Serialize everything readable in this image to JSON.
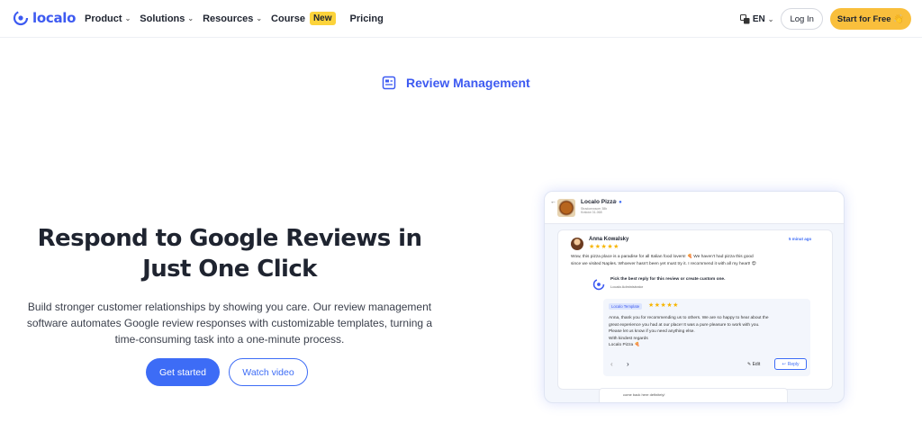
{
  "nav": {
    "logo_text": "localo",
    "menu": [
      {
        "label": "Product",
        "has_dropdown": true
      },
      {
        "label": "Solutions",
        "has_dropdown": true
      },
      {
        "label": "Resources",
        "has_dropdown": true
      },
      {
        "label": "Course",
        "badge": "New"
      },
      {
        "label": "Pricing"
      }
    ],
    "language": "EN",
    "login_label": "Log In",
    "start_label": "Start for Free 👋"
  },
  "section": {
    "label": "Review Management",
    "icon": "document-list-icon"
  },
  "hero": {
    "title_line1": "Respond to Google Reviews in",
    "title_line2": "Just One Click",
    "subtitle_line1": "Build stronger customer relationships by showing you care. Our review management",
    "subtitle_line2": "software automates Google review responses with customizable templates, turning a",
    "subtitle_line3": "time-consuming task into a one-minute process.",
    "primary_button": "Get started",
    "secondary_button": "Watch video"
  },
  "mockup": {
    "business_name": "Localo Pizza",
    "business_meta_1": "Stradomwscer 38b",
    "business_meta_2": "Kraków 31-068",
    "review": {
      "author": "Anna Kowalsky",
      "stars": "★★★★★",
      "time": "5 minut ago",
      "text_line1": "Wow, this pizza place is a paradise for all Italian food lovers! 🍕 We haven't had pizza this good",
      "text_line2": "since we visited Naples. Whoever hasn't been yet must try it. I recommend it with all my heart! 😍"
    },
    "pick": {
      "title": "Pick the best reply for this review or create custom one.",
      "subtitle": "Localo Administrator"
    },
    "template": {
      "badge": "Localo Template",
      "stars": "★★★★★",
      "line1": "Anna, thank you for recommending us to others. We are so happy to hear about the",
      "line2": "great experience you had at our place! It was a pure pleasure to work with you.",
      "line3": "Please let us know if you need anything else.",
      "line4": "With kindest regards",
      "line5": "Localo Pizza 🍕",
      "edit_label": "Edit",
      "reply_label": "Reply"
    },
    "under_text": "come back here definitely!"
  },
  "colors": {
    "brand_blue": "#3d5af1",
    "button_blue": "#3d6cf6",
    "cta_yellow": "#f9bf3c",
    "badge_yellow": "#fcd33b",
    "star_gold": "#f7b500"
  }
}
